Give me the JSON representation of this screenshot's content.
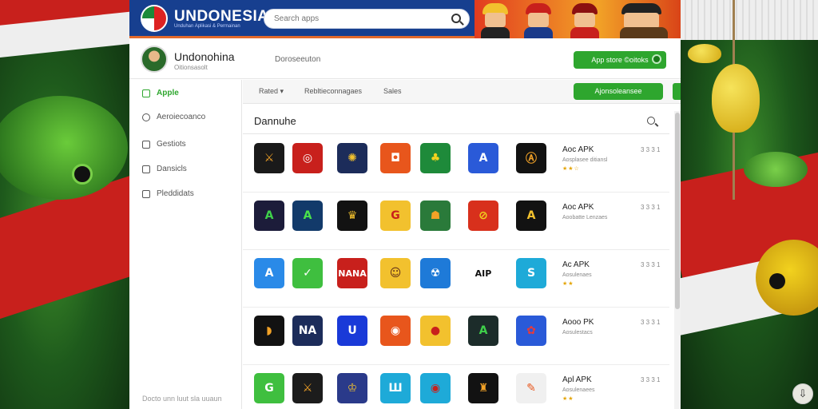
{
  "header": {
    "brand": "UNDONESIA",
    "brand_sub": "Unduhan Aplikasi & Permainan",
    "search_placeholder": "Search apps"
  },
  "profile": {
    "name": "Undonohina",
    "subtitle": "Oitionsasolt",
    "center_text": "Doroseeuton",
    "action_label": "App store ©oitoks"
  },
  "sidebar": {
    "items": [
      {
        "label": "Apple",
        "icon": "home-icon",
        "active": true
      },
      {
        "label": "Aeroiecoanco",
        "icon": "search-icon",
        "active": false
      },
      {
        "label": "Gestiots",
        "icon": "calendar-icon",
        "active": false
      },
      {
        "label": "Dansicls",
        "icon": "grid-icon",
        "active": false
      },
      {
        "label": "Pleddidats",
        "icon": "document-icon",
        "active": false
      }
    ],
    "footer": "Docto unn luut sla uuaun"
  },
  "subbar": {
    "tabs": [
      "Rated ▾",
      "Rebltieconnagaes",
      "Sales"
    ],
    "button_label": "Ajonsoleansee"
  },
  "content": {
    "title": "Dannuhe",
    "rows": [
      {
        "icons": [
          {
            "glyph": "⚔",
            "bg": "#1a1a1a",
            "fg": "#f2a227"
          },
          {
            "glyph": "◎",
            "bg": "#c8201c",
            "fg": "#ffffff"
          },
          {
            "glyph": "✺",
            "bg": "#1c2c5a",
            "fg": "#f2c12e"
          },
          {
            "glyph": "◘",
            "bg": "#e8561c",
            "fg": "#ffffff"
          },
          {
            "glyph": "♣",
            "bg": "#1e8a3a",
            "fg": "#f2d21e"
          },
          {
            "glyph": "A",
            "bg": "#2a5ad8",
            "fg": "#ffffff"
          },
          {
            "glyph": "Ⓐ",
            "bg": "#121212",
            "fg": "#f2a227"
          }
        ],
        "name": "Aoc APK",
        "sub": "Aosplasee ditiansl",
        "stars": "★★☆",
        "right": "3 3 3 1"
      },
      {
        "icons": [
          {
            "glyph": "A",
            "bg": "#1c1c3a",
            "fg": "#3fd14a"
          },
          {
            "glyph": "A",
            "bg": "#123a6a",
            "fg": "#4ae24a"
          },
          {
            "glyph": "♛",
            "bg": "#121212",
            "fg": "#f2c12e"
          },
          {
            "glyph": "G",
            "bg": "#f2c12e",
            "fg": "#c8201c"
          },
          {
            "glyph": "☗",
            "bg": "#2a7a3a",
            "fg": "#f2a227"
          },
          {
            "glyph": "⊘",
            "bg": "#d8301c",
            "fg": "#f2d21e"
          },
          {
            "glyph": "A",
            "bg": "#121212",
            "fg": "#f2c12e"
          }
        ],
        "name": "Aoc APK",
        "sub": "Aoobatte Lenzaes",
        "stars": "",
        "right": "3 3 3 1"
      },
      {
        "icons": [
          {
            "glyph": "A",
            "bg": "#2a8ae8",
            "fg": "#ffffff"
          },
          {
            "glyph": "✓",
            "bg": "#3fbf3f",
            "fg": "#ffffff"
          },
          {
            "glyph": "NANA",
            "bg": "#c8201c",
            "fg": "#ffffff"
          },
          {
            "glyph": "☺",
            "bg": "#f2c12e",
            "fg": "#5a2a1a"
          },
          {
            "glyph": "☢",
            "bg": "#1e7ad8",
            "fg": "#ffffff"
          },
          {
            "glyph": "AIP",
            "bg": "#ffffff",
            "fg": "#111111"
          },
          {
            "glyph": "S",
            "bg": "#1eaad8",
            "fg": "#ffffff"
          }
        ],
        "name": "Ac APK",
        "sub": "Aosulenaes",
        "stars": "★★",
        "right": "3 3 3 1"
      },
      {
        "icons": [
          {
            "glyph": "◗",
            "bg": "#121212",
            "fg": "#f2a227"
          },
          {
            "glyph": "NA",
            "bg": "#1c2c5a",
            "fg": "#ffffff"
          },
          {
            "glyph": "U",
            "bg": "#1a3ad8",
            "fg": "#ffffff"
          },
          {
            "glyph": "◉",
            "bg": "#e8561c",
            "fg": "#ffffff"
          },
          {
            "glyph": "●",
            "bg": "#f2c12e",
            "fg": "#c8201c"
          },
          {
            "glyph": "A",
            "bg": "#1c2c2a",
            "fg": "#3fd14a"
          },
          {
            "glyph": "✿",
            "bg": "#2a5ad8",
            "fg": "#e83a3a"
          }
        ],
        "name": "Aooo PK",
        "sub": "Aosulestacs",
        "stars": "",
        "right": "3 3 3 1"
      },
      {
        "icons": [
          {
            "glyph": "G",
            "bg": "#3fbf3f",
            "fg": "#ffffff"
          },
          {
            "glyph": "⚔",
            "bg": "#1c1c1c",
            "fg": "#f2a227"
          },
          {
            "glyph": "♔",
            "bg": "#2a3a8a",
            "fg": "#f2c12e"
          },
          {
            "glyph": "Ш",
            "bg": "#1eaad8",
            "fg": "#ffffff"
          },
          {
            "glyph": "◉",
            "bg": "#1eaad8",
            "fg": "#c8201c"
          },
          {
            "glyph": "♜",
            "bg": "#121212",
            "fg": "#f2a227"
          },
          {
            "glyph": "✎",
            "bg": "#f0f0f0",
            "fg": "#e8561c"
          }
        ],
        "name": "Apl APK",
        "sub": "Aosulenaees",
        "stars": "★★",
        "right": "3 3 3 1"
      }
    ]
  },
  "fab_glyph": "⇩"
}
